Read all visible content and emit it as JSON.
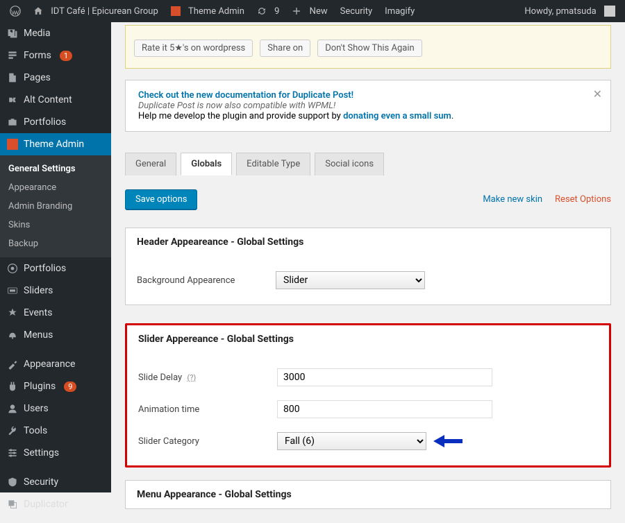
{
  "adminbar": {
    "site": "IDT Café | Epicurean Group",
    "theme_admin": "Theme Admin",
    "updates_count": "9",
    "new": "New",
    "security": "Security",
    "imagify": "Imagify",
    "howdy": "Howdy, pmatsuda"
  },
  "sidebar": {
    "items": [
      {
        "label": "Media"
      },
      {
        "label": "Forms",
        "badge": "1"
      },
      {
        "label": "Pages"
      },
      {
        "label": "Alt Content"
      },
      {
        "label": "Portfolios"
      },
      {
        "label": "Theme Admin",
        "active": true
      },
      {
        "label": "Portfolios"
      },
      {
        "label": "Sliders"
      },
      {
        "label": "Events"
      },
      {
        "label": "Menus"
      },
      {
        "label": "Appearance"
      },
      {
        "label": "Plugins",
        "badge": "9"
      },
      {
        "label": "Users"
      },
      {
        "label": "Tools"
      },
      {
        "label": "Settings"
      },
      {
        "label": "Security"
      },
      {
        "label": "Duplicator"
      }
    ],
    "submenu": [
      {
        "label": "General Settings",
        "current": true
      },
      {
        "label": "Appearance"
      },
      {
        "label": "Admin Branding"
      },
      {
        "label": "Skins"
      },
      {
        "label": "Backup"
      }
    ]
  },
  "notice_yellow": {
    "rate": "Rate it 5★'s on wordpress",
    "share": "Share on",
    "dismiss": "Don't Show This Again"
  },
  "notice_white": {
    "link1": "Check out the new documentation for Duplicate Post!",
    "line2": "Duplicate Post is now also compatible with WPML!",
    "line3a": "Help me develop the plugin and provide support by ",
    "link2": "donating even a small sum",
    "line3b": "."
  },
  "tabs": [
    "General",
    "Globals",
    "Editable Type",
    "Social icons"
  ],
  "actions": {
    "save": "Save options",
    "makeskin": "Make new skin",
    "reset": "Reset Options"
  },
  "header_panel": {
    "title": "Header Appeareance - Global Settings",
    "bg_label": "Background Appearence",
    "bg_value": "Slider"
  },
  "slider_panel": {
    "title": "Slider Appereance - Global Settings",
    "delay_label": "Slide Delay",
    "delay_help": "(?)",
    "delay_value": "3000",
    "anim_label": "Animation time",
    "anim_value": "800",
    "cat_label": "Slider Category",
    "cat_value": "Fall  (6)"
  },
  "menu_panel": {
    "title": "Menu Appearance - Global Settings"
  }
}
